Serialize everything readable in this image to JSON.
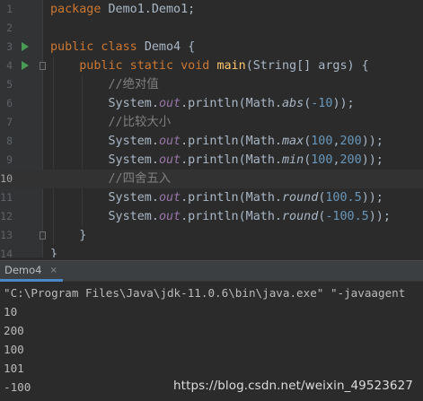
{
  "editor": {
    "current_line": 10,
    "lines": [
      {
        "n": "1",
        "tokens": [
          [
            "kw",
            "package "
          ],
          [
            "",
            "Demo1.Demo1;"
          ]
        ]
      },
      {
        "n": "2",
        "tokens": []
      },
      {
        "n": "3",
        "run": true,
        "tokens": [
          [
            "kw",
            "public class "
          ],
          [
            "",
            "Demo4 {"
          ]
        ]
      },
      {
        "n": "4",
        "run": true,
        "fold": true,
        "tokens": [
          [
            "",
            "    "
          ],
          [
            "kw",
            "public static void "
          ],
          [
            "fn",
            "main"
          ],
          [
            "",
            "(String[] args) {"
          ]
        ]
      },
      {
        "n": "5",
        "tokens": [
          [
            "",
            "        "
          ],
          [
            "cm",
            "//绝对值"
          ]
        ]
      },
      {
        "n": "6",
        "tokens": [
          [
            "",
            "        System."
          ],
          [
            "st",
            "out"
          ],
          [
            "",
            ".println(Math."
          ],
          [
            "it",
            "abs"
          ],
          [
            "",
            "("
          ],
          [
            "num",
            "-10"
          ],
          [
            "",
            "));"
          ]
        ]
      },
      {
        "n": "7",
        "tokens": [
          [
            "",
            "        "
          ],
          [
            "cm",
            "//比较大小"
          ]
        ]
      },
      {
        "n": "8",
        "tokens": [
          [
            "",
            "        System."
          ],
          [
            "st",
            "out"
          ],
          [
            "",
            ".println(Math."
          ],
          [
            "it",
            "max"
          ],
          [
            "",
            "("
          ],
          [
            "num",
            "100"
          ],
          [
            "",
            ","
          ],
          [
            "num",
            "200"
          ],
          [
            "",
            "));"
          ]
        ]
      },
      {
        "n": "9",
        "tokens": [
          [
            "",
            "        System."
          ],
          [
            "st",
            "out"
          ],
          [
            "",
            ".println(Math."
          ],
          [
            "it",
            "min"
          ],
          [
            "",
            "("
          ],
          [
            "num",
            "100"
          ],
          [
            "",
            ","
          ],
          [
            "num",
            "200"
          ],
          [
            "",
            "));"
          ]
        ]
      },
      {
        "n": "10",
        "tokens": [
          [
            "",
            "        "
          ],
          [
            "cm",
            "//四舍五入"
          ]
        ]
      },
      {
        "n": "11",
        "tokens": [
          [
            "",
            "        System."
          ],
          [
            "st",
            "out"
          ],
          [
            "",
            ".println(Math."
          ],
          [
            "it",
            "round"
          ],
          [
            "",
            "("
          ],
          [
            "num",
            "100.5"
          ],
          [
            "",
            "));"
          ]
        ]
      },
      {
        "n": "12",
        "tokens": [
          [
            "",
            "        System."
          ],
          [
            "st",
            "out"
          ],
          [
            "",
            ".println(Math."
          ],
          [
            "it",
            "round"
          ],
          [
            "",
            "("
          ],
          [
            "num",
            "-100.5"
          ],
          [
            "",
            "));"
          ]
        ]
      },
      {
        "n": "13",
        "fold": true,
        "tokens": [
          [
            "",
            "    }"
          ]
        ]
      },
      {
        "n": "14",
        "tokens": [
          [
            "",
            "}"
          ]
        ]
      }
    ]
  },
  "console": {
    "tab_label": "Demo4",
    "close_glyph": "×",
    "command": "\"C:\\Program Files\\Java\\jdk-11.0.6\\bin\\java.exe\" \"-javaagent",
    "output": [
      "10",
      "200",
      "100",
      "101",
      "-100"
    ]
  },
  "watermark": "https://blog.csdn.net/weixin_49523627",
  "colors": {
    "background": "#2b2b2b",
    "keyword": "#cc7832",
    "method_decl": "#ffc66d",
    "static_field": "#9876aa",
    "number": "#6897bb",
    "comment": "#808080",
    "run_icon": "#499c54",
    "tab_underline": "#4a88c7"
  }
}
